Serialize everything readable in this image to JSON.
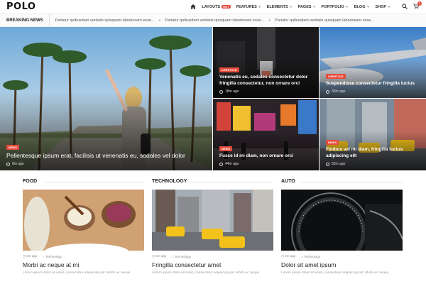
{
  "header": {
    "logo": "POLO",
    "nav": [
      {
        "label": "LAYOUTS",
        "badge": "HOT"
      },
      {
        "label": "FEATURES"
      },
      {
        "label": "ELEMENTS"
      },
      {
        "label": "PAGES"
      },
      {
        "label": "PORTFOLIO"
      },
      {
        "label": "BLOG"
      },
      {
        "label": "SHOP"
      }
    ],
    "cart_count": "0"
  },
  "breaking": {
    "label": "BREAKING NEWS",
    "items": [
      "Pariatur quibusdam veritatis quisquam laboriosam esse...",
      "Pariatur quibusdam veritatis quisquam laboriosam esse...",
      "Pariatur quibusdam veritatis quisquam laboriosam esse..."
    ]
  },
  "hero": {
    "main": {
      "badge": "NEWS",
      "title": "Pellentesque ipsum erat, facilisis ut venenatis eu, sodales vel dolor",
      "meta": "6m ago"
    },
    "top_mid": {
      "badge": "LIFESTYLE",
      "title": "Venenatis eu, sodales consectetur dolor fringilla consectetur, non ornare orci",
      "meta": "18m ago"
    },
    "top_right": {
      "badge": "LIFESTYLE",
      "title": "Suspendisse consectetur fringilla luctus",
      "meta": "33m ago"
    },
    "bot_mid": {
      "badge": "NEWS",
      "title": "Fusce id mi diam, non ornare orci",
      "meta": "44m ago"
    },
    "bot_right": {
      "badge": "NEWS",
      "title": "Finibus vel mi diam, fringilla luctus adipiscing elit",
      "meta": "55m ago"
    }
  },
  "columns": [
    {
      "head": "FOOD",
      "meta_time": "6m ago",
      "meta_tag": "Technology",
      "title": "Morbi ac neque at mi",
      "excerpt": "Lorem ipsum dolor sit amet, consectetur adipiscing elit. Morbi ac neque"
    },
    {
      "head": "TECHNOLOGY",
      "meta_time": "6m ago",
      "meta_tag": "Technology",
      "title": "Fringilla consectetur amet",
      "excerpt": "Lorem ipsum dolor sit amet, consectetur adipiscing elit. Morbi ac neque"
    },
    {
      "head": "AUTO",
      "meta_time": "6m ago",
      "meta_tag": "Technology",
      "title": "Dolor sit amet ipsum",
      "excerpt": "Lorem ipsum dolor sit amet, consectetur adipiscing elit. Morbi ac neque"
    }
  ],
  "colors": {
    "accent": "#e74c3c"
  }
}
